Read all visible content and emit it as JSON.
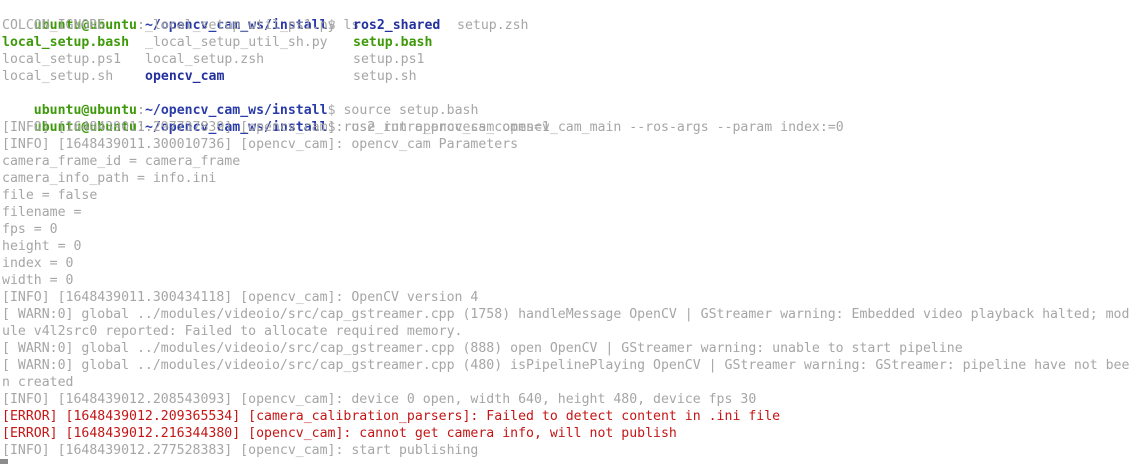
{
  "prompt": {
    "user": "ubuntu@ubuntu",
    "sep": ":",
    "path": "~/opencv_cam_ws/install",
    "suffix": "$ "
  },
  "commands": {
    "ls": "ls",
    "source": "source setup.bash",
    "run": "ros2 run opencv_cam opencv_cam_main --ros-args --param index:=0"
  },
  "ls_output": {
    "row1": [
      "COLCON_IGNORE",
      "_local_setup_util_ps1.py",
      "ros2_shared",
      "setup.zsh"
    ],
    "row2": [
      "local_setup.bash",
      "_local_setup_util_sh.py",
      "setup.bash"
    ],
    "row3": [
      "local_setup.ps1",
      "local_setup.zsh",
      "setup.ps1"
    ],
    "row4": [
      "local_setup.sh",
      "opencv_cam",
      "setup.sh"
    ]
  },
  "log_lines": [
    "[INFO] [1648439011.297737839] [opencv_cam]: use_intra_process_comms=1",
    "[INFO] [1648439011.300010736] [opencv_cam]: opencv_cam Parameters",
    "camera_frame_id = camera_frame",
    "camera_info_path = info.ini",
    "file = false",
    "filename =",
    "fps = 0",
    "height = 0",
    "index = 0",
    "width = 0",
    "[INFO] [1648439011.300434118] [opencv_cam]: OpenCV version 4",
    "[ WARN:0] global ../modules/videoio/src/cap_gstreamer.cpp (1758) handleMessage OpenCV | GStreamer warning: Embedded video playback halted; mod",
    "ule v4l2src0 reported: Failed to allocate required memory.",
    "[ WARN:0] global ../modules/videoio/src/cap_gstreamer.cpp (888) open OpenCV | GStreamer warning: unable to start pipeline",
    "[ WARN:0] global ../modules/videoio/src/cap_gstreamer.cpp (480) isPipelinePlaying OpenCV | GStreamer warning: GStreamer: pipeline have not bee",
    "n created",
    "[INFO] [1648439012.208543093] [opencv_cam]: device 0 open, width 640, height 480, device fps 30"
  ],
  "error_lines": [
    "[ERROR] [1648439012.209365534] [camera_calibration_parsers]: Failed to detect content in .ini file",
    "[ERROR] [1648439012.216344380] [opencv_cam]: cannot get camera info, will not publish"
  ],
  "final_line": "[INFO] [1648439012.277528383] [opencv_cam]: start publishing",
  "colors": {
    "background": "#ffffff",
    "user": "#3e9a0a",
    "path": "#2a3ca8",
    "directory": "#23319e",
    "executable": "#3e9a0a",
    "plain_text": "#a6a6a6",
    "error": "#c41616"
  }
}
